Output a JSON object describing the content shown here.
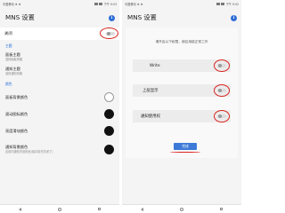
{
  "colors": {
    "accent": "#2f6fd6",
    "annotation": "#d8241f",
    "button": "#3d7ad8"
  },
  "left": {
    "status": {
      "carrier": "中国移动 ❖ ❖",
      "time": "下午 9:53"
    },
    "title": "MNS 设置",
    "master_toggle": {
      "label": "关闭"
    },
    "sections": [
      {
        "header": "主题",
        "items": [
          {
            "title": "面板主题",
            "subtitle": "选择面板风格"
          },
          {
            "title": "通知主题",
            "subtitle": "选择通知风格"
          }
        ]
      },
      {
        "header": "颜色",
        "colors": [
          {
            "title": "面板背景颜色",
            "subtitle": "",
            "swatch": "#ffffff"
          },
          {
            "title": "滚动图标颜色",
            "subtitle": "",
            "swatch": "#111111"
          },
          {
            "title": "亮度滑块颜色",
            "subtitle": "",
            "swatch": "#111111"
          },
          {
            "title": "通知背景颜色",
            "subtitle": "应用内通知背景颜色(保存前先关闭了)",
            "swatch": "#111111"
          }
        ]
      }
    ]
  },
  "right": {
    "status": {
      "carrier": "中国移动 ❖ ❖",
      "time": "下午 9:52"
    },
    "title": "MNS 设置",
    "message": "请开启以下权限，使应用能正常工作",
    "permissions": [
      {
        "label": "Write"
      },
      {
        "label": "上层显示"
      },
      {
        "label": "通知使用权"
      }
    ],
    "done_label": "完成"
  },
  "icons": {
    "info": "i",
    "toggle": "toggle-off"
  }
}
